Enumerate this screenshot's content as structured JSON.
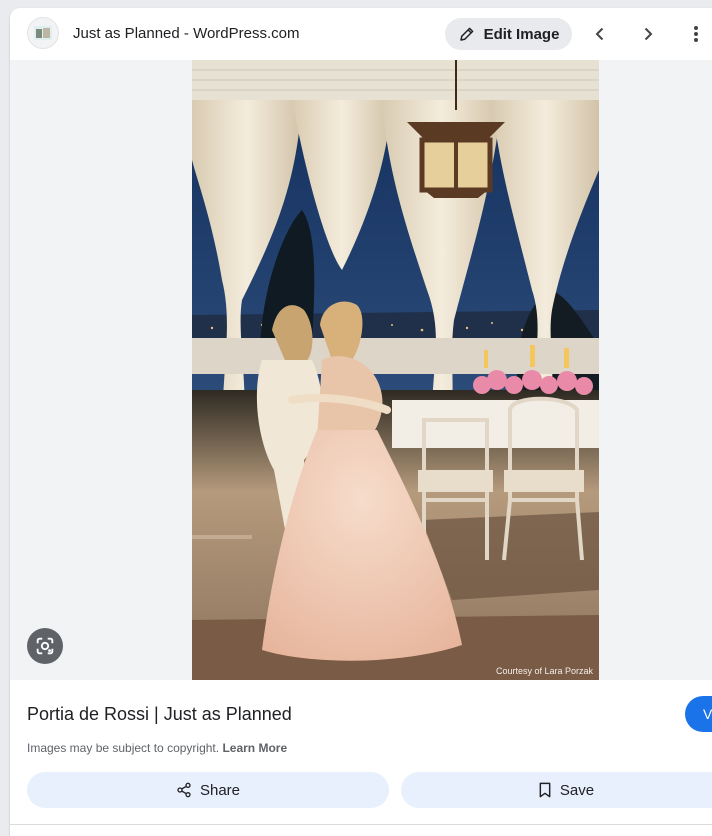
{
  "header": {
    "source_title": "Just as Planned - WordPress.com",
    "edit_label": "Edit Image",
    "icons": [
      "favicon",
      "pencil-icon",
      "chevron-left-icon",
      "chevron-right-icon",
      "more-vert-icon"
    ]
  },
  "image": {
    "credit": "Courtesy of Lara Porzak"
  },
  "info": {
    "title": "Portia de Rossi | Just as Planned",
    "visit_label": "V",
    "copyright_text": "Images may be subject to copyright.",
    "learn_more": "Learn More"
  },
  "actions": {
    "share_label": "Share",
    "save_label": "Save"
  },
  "colors": {
    "accent": "#1a73e8",
    "action_bg": "#e8f0fe",
    "edit_bg": "#e8eaed"
  }
}
